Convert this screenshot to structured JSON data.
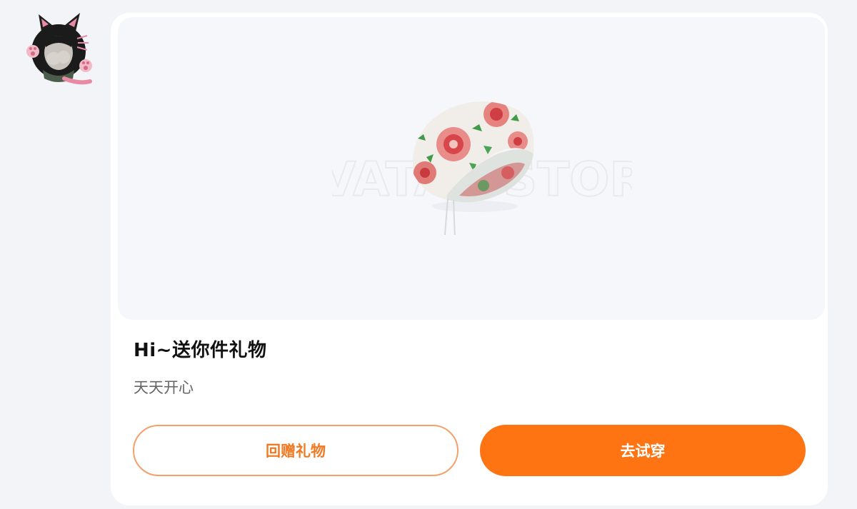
{
  "sender": {
    "avatar_icon": "cat-avatar-icon"
  },
  "gift_card": {
    "product_icon": "floral-beanie-hat-icon",
    "watermark_text": "AVATAR STORE",
    "title": "Hi~送你件礼物",
    "message": "天天开心",
    "return_gift_button": "回赠礼物",
    "try_on_button": "去试穿"
  },
  "colors": {
    "page_background": "#f3f4f8",
    "card_background": "#ffffff",
    "preview_background": "#f6f7fb",
    "accent_orange": "#ff7412",
    "outline_orange": "#f4a06a",
    "title_text": "#111111",
    "message_text": "#666666"
  }
}
